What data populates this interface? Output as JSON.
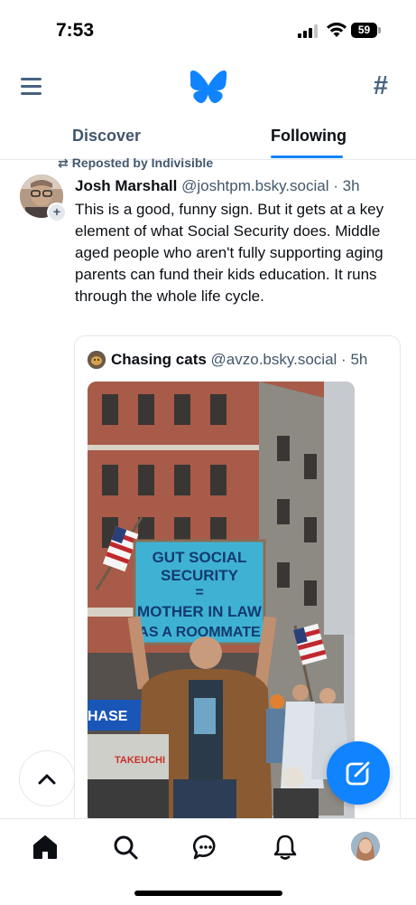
{
  "status_bar": {
    "time": "7:53",
    "battery": "59"
  },
  "icons": {
    "menu": "menu-icon",
    "logo": "butterfly-icon",
    "feeds": "hash-icon",
    "repost": "repost-icon",
    "scroll_top": "chevron-up-icon",
    "compose": "compose-icon",
    "home": "home-icon",
    "search": "search-icon",
    "chat": "chat-icon",
    "notifications": "bell-icon"
  },
  "header": {
    "hash_glyph": "#"
  },
  "tabs": [
    {
      "label": "Discover",
      "active": false
    },
    {
      "label": "Following",
      "active": true
    }
  ],
  "post": {
    "repost_label": "Reposted by Indivisible",
    "author": "Josh Marshall",
    "handle": "@joshtpm.bsky.social",
    "separator": " · ",
    "time": "3h",
    "avatar_badge": "+",
    "text": "This is a good, funny sign. But it gets at a key element of what Social Security does. Middle aged people who aren't fully supporting aging parents can fund their kids education. It runs through the whole life cycle.",
    "quote": {
      "author": "Chasing cats",
      "handle": "@avzo.bsky.social",
      "separator": " · ",
      "time": "5h",
      "image": {
        "sign_lines": [
          "GUT SOCIAL",
          "SECURITY",
          "=",
          "MOTHER IN LAW",
          "AS A ROOMMATE"
        ],
        "bank_sign": "HASE",
        "machine_label": "TAKEUCHI"
      }
    }
  },
  "colors": {
    "accent": "#1083fe",
    "icon_gray": "#46627f",
    "secondary_text": "#42576c",
    "border": "#e4e8ec"
  }
}
